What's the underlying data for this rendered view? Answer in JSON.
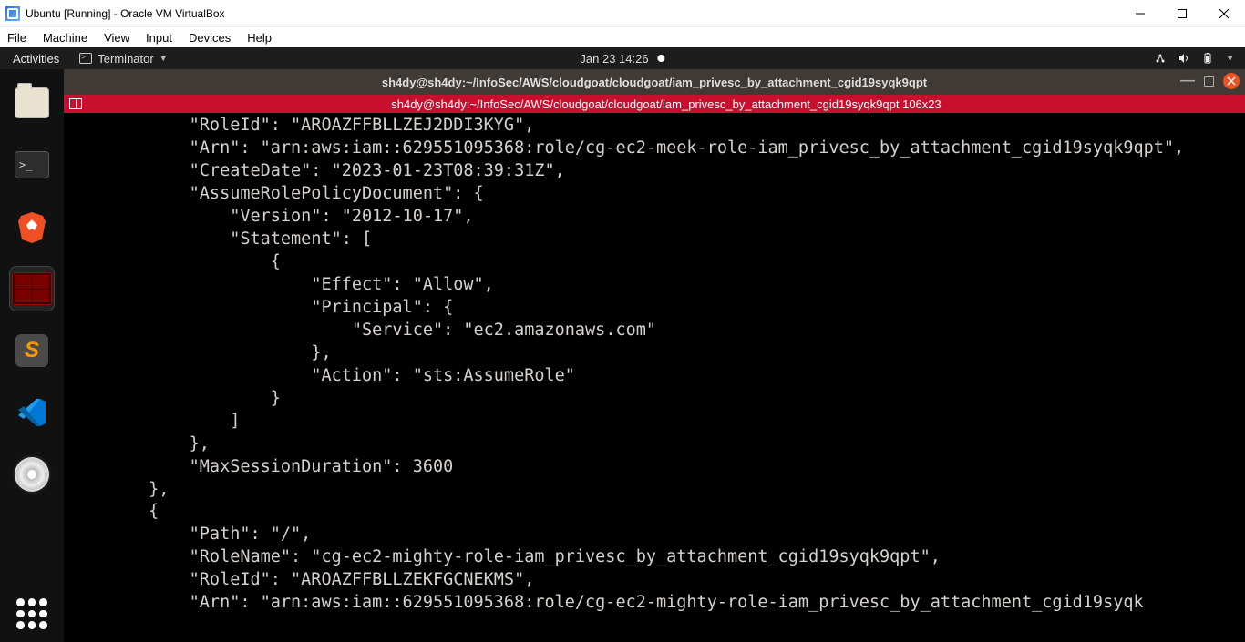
{
  "host_window": {
    "title": "Ubuntu [Running] - Oracle VM VirtualBox",
    "menu": [
      "File",
      "Machine",
      "View",
      "Input",
      "Devices",
      "Help"
    ]
  },
  "gnome_topbar": {
    "activities": "Activities",
    "app_name": "Terminator",
    "datetime": "Jan 23  14:26"
  },
  "dock": {
    "items": [
      {
        "name": "files",
        "label": "Files"
      },
      {
        "name": "terminal-basic",
        "label": "Terminal"
      },
      {
        "name": "brave",
        "label": "Brave"
      },
      {
        "name": "terminator",
        "label": "Terminator",
        "active": true
      },
      {
        "name": "sublime",
        "label": "Sublime Text"
      },
      {
        "name": "vscode",
        "label": "VS Code"
      },
      {
        "name": "disc",
        "label": "Disc"
      }
    ],
    "apps_button": "Show Applications"
  },
  "terminal": {
    "window_title": "sh4dy@sh4dy:~/InfoSec/AWS/cloudgoat/cloudgoat/iam_privesc_by_attachment_cgid19syqk9qpt",
    "tab_label": "sh4dy@sh4dy:~/InfoSec/AWS/cloudgoat/cloudgoat/iam_privesc_by_attachment_cgid19syqk9qpt 106x23",
    "content": "            \"RoleId\": \"AROAZFFBLLZEJ2DDI3KYG\",\n            \"Arn\": \"arn:aws:iam::629551095368:role/cg-ec2-meek-role-iam_privesc_by_attachment_cgid19syqk9qpt\",\n            \"CreateDate\": \"2023-01-23T08:39:31Z\",\n            \"AssumeRolePolicyDocument\": {\n                \"Version\": \"2012-10-17\",\n                \"Statement\": [\n                    {\n                        \"Effect\": \"Allow\",\n                        \"Principal\": {\n                            \"Service\": \"ec2.amazonaws.com\"\n                        },\n                        \"Action\": \"sts:AssumeRole\"\n                    }\n                ]\n            },\n            \"MaxSessionDuration\": 3600\n        },\n        {\n            \"Path\": \"/\",\n            \"RoleName\": \"cg-ec2-mighty-role-iam_privesc_by_attachment_cgid19syqk9qpt\",\n            \"RoleId\": \"AROAZFFBLLZEKFGCNEKMS\",\n            \"Arn\": \"arn:aws:iam::629551095368:role/cg-ec2-mighty-role-iam_privesc_by_attachment_cgid19syqk"
  }
}
